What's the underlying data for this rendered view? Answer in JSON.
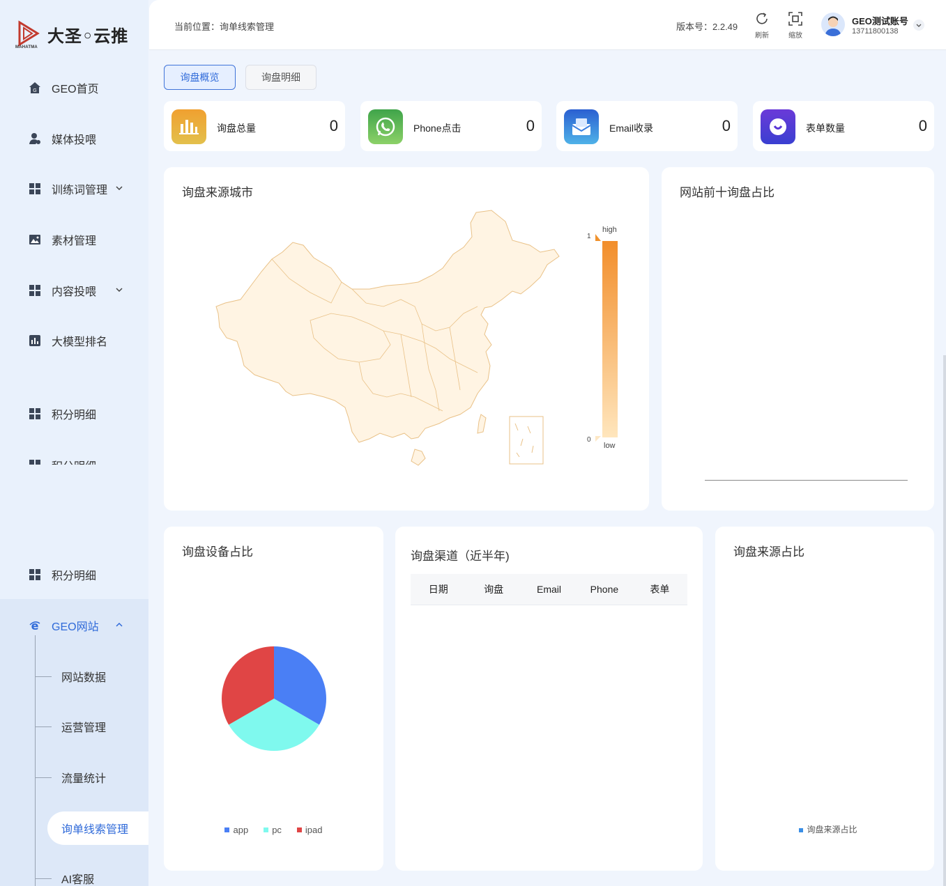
{
  "brand": {
    "name": "大圣◦云推",
    "sub": "MAHATMA"
  },
  "sidebar": {
    "items": [
      {
        "label": "GEO首页",
        "icon": "home-icon"
      },
      {
        "label": "媒体投喂",
        "icon": "user-icon"
      },
      {
        "label": "训练词管理",
        "icon": "grid-icon"
      },
      {
        "label": "素材管理",
        "icon": "image-icon"
      },
      {
        "label": "内容投喂",
        "icon": "grid-icon"
      },
      {
        "label": "大模型排名",
        "icon": "bar-chart-icon"
      },
      {
        "label": "积分明细",
        "icon": "grid-icon"
      },
      {
        "label": "积分明细",
        "icon": "grid-icon"
      },
      {
        "label": "积分明细",
        "icon": "grid-icon"
      }
    ],
    "geo_group": {
      "label": "GEO网站",
      "children": [
        "网站数据",
        "运营管理",
        "流量统计",
        "询单线索管理",
        "AI客服"
      ]
    }
  },
  "header": {
    "breadcrumb": "当前位置：询单线索管理",
    "version": "版本号：2.2.49",
    "refresh": "刷新",
    "zoom": "缩放",
    "user_name": "GEO测试账号",
    "user_phone": "13711800138"
  },
  "tabs": [
    "询盘概览",
    "询盘明细"
  ],
  "stats": [
    {
      "label": "询盘总量",
      "value": "0",
      "color": "#e9a72c"
    },
    {
      "label": "Phone点击",
      "value": "0",
      "color": "#4caf50"
    },
    {
      "label": "Email收录",
      "value": "0",
      "color": "#2f8de4"
    },
    {
      "label": "表单数量",
      "value": "0",
      "color": "#5a36d6"
    }
  ],
  "panels": {
    "map_title": "询盘来源城市",
    "top10_title": "网站前十询盘占比",
    "device_title": "询盘设备占比",
    "channel_title": "询盘渠道（近半年)",
    "source_title": "询盘来源占比"
  },
  "visual_map": {
    "high": "high",
    "low": "low",
    "max": "1",
    "min": "0"
  },
  "channel_table": {
    "columns": [
      "日期",
      "询盘",
      "Email",
      "Phone",
      "表单"
    ]
  },
  "source_legend": "询盘来源占比",
  "chart_data": {
    "type": "pie",
    "title": "询盘设备占比",
    "categories": [
      "app",
      "pc",
      "ipad"
    ],
    "values": [
      1,
      1,
      1
    ],
    "colors": [
      "#4a7ff5",
      "#7ff9ee",
      "#e04545"
    ],
    "legend_position": "bottom"
  }
}
